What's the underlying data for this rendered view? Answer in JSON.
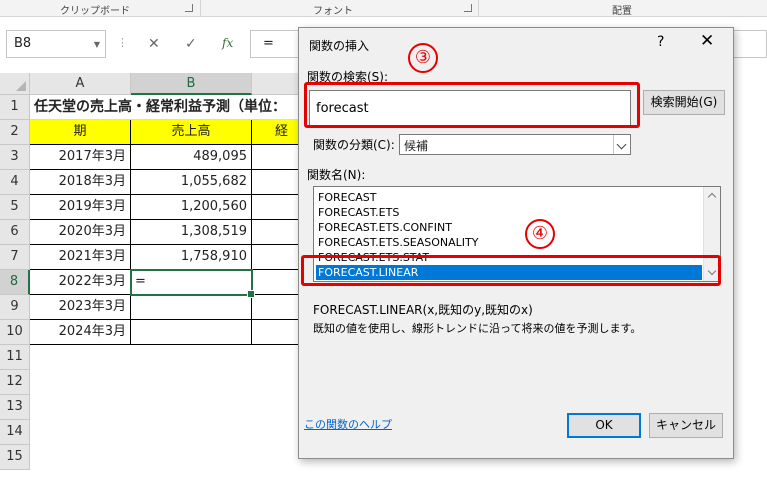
{
  "ribbon": {
    "groups": [
      "クリップボード",
      "フォント",
      "配置"
    ]
  },
  "formula_bar": {
    "name_box": "B8",
    "cancel_icon": "✕",
    "enter_icon": "✓",
    "fx_label": "fx",
    "content": "="
  },
  "sheet": {
    "columns": [
      "A",
      "B"
    ],
    "rows": [
      "1",
      "2",
      "3",
      "4",
      "5",
      "6",
      "7",
      "8",
      "9",
      "10",
      "11",
      "12",
      "13",
      "14",
      "15"
    ],
    "title": "任天堂の売上高・経常利益予測（単位：",
    "headers": [
      "期",
      "売上高",
      "経"
    ],
    "data": [
      {
        "period": "2017年3月",
        "sales": "489,095"
      },
      {
        "period": "2018年3月",
        "sales": "1,055,682"
      },
      {
        "period": "2019年3月",
        "sales": "1,200,560"
      },
      {
        "period": "2020年3月",
        "sales": "1,308,519"
      },
      {
        "period": "2021年3月",
        "sales": "1,758,910"
      },
      {
        "period": "2022年3月",
        "sales": "="
      },
      {
        "period": "2023年3月",
        "sales": ""
      },
      {
        "period": "2024年3月",
        "sales": ""
      }
    ]
  },
  "dialog": {
    "title": "関数の挿入",
    "help_icon": "?",
    "close_icon": "✕",
    "search_label": "関数の検索(S):",
    "search_value": "forecast",
    "search_button": "検索開始(G)",
    "category_label": "関数の分類(C):",
    "category_value": "候補",
    "function_list_label": "関数名(N):",
    "functions": [
      "FORECAST",
      "FORECAST.ETS",
      "FORECAST.ETS.CONFINT",
      "FORECAST.ETS.SEASONALITY",
      "FORECAST.ETS.STAT",
      "FORECAST.LINEAR"
    ],
    "selected_function": "FORECAST.LINEAR",
    "syntax": "FORECAST.LINEAR(x,既知のy,既知のx)",
    "description": "既知の値を使用し、線形トレンドに沿って将来の値を予測します。",
    "help_link": "この関数のヘルプ",
    "ok_button": "OK",
    "cancel_button": "キャンセル"
  },
  "annotations": {
    "step3": "③",
    "step4": "④",
    "highlight_color": "#e60000"
  },
  "colors": {
    "excel_green": "#217346",
    "selection_blue": "#0078d7",
    "header_yellow": "#ffff00"
  }
}
